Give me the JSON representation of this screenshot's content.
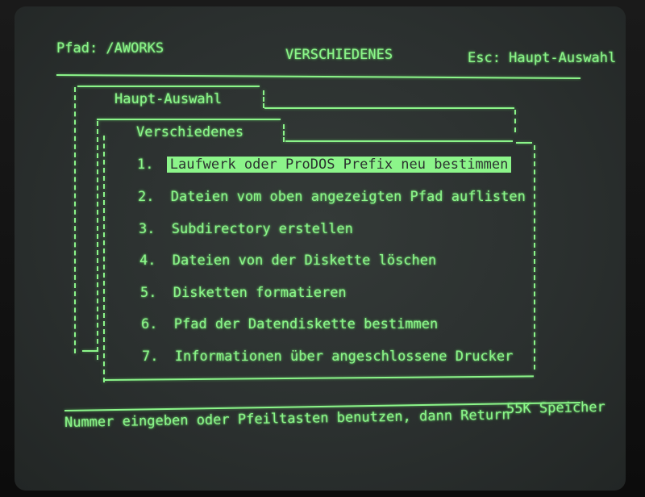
{
  "header": {
    "path_label": "Pfad: /AWORKS",
    "title": "VERSCHIEDENES",
    "esc_label": "Esc: Haupt-Auswahl"
  },
  "windows": {
    "main_title": "Haupt-Auswahl",
    "sub_title": "Verschiedenes"
  },
  "menu": {
    "items": [
      {
        "number": "1.",
        "label": "Laufwerk oder ProDOS Prefix neu bestimmen"
      },
      {
        "number": "2.",
        "label": "Dateien vom oben angezeigten Pfad auflisten"
      },
      {
        "number": "3.",
        "label": "Subdirectory erstellen"
      },
      {
        "number": "4.",
        "label": "Dateien von der Diskette löschen"
      },
      {
        "number": "5.",
        "label": "Disketten formatieren"
      },
      {
        "number": "6.",
        "label": "Pfad der Datendiskette bestimmen"
      },
      {
        "number": "7.",
        "label": "Informationen über angeschlossene Drucker"
      }
    ],
    "selected_index": 0
  },
  "footer": {
    "hint": "Nummer eingeben oder Pfeiltasten benutzen, dann Return",
    "memory": "55K Speicher"
  },
  "colors": {
    "phosphor": "#8cf58a",
    "screen": "#2e3332"
  }
}
